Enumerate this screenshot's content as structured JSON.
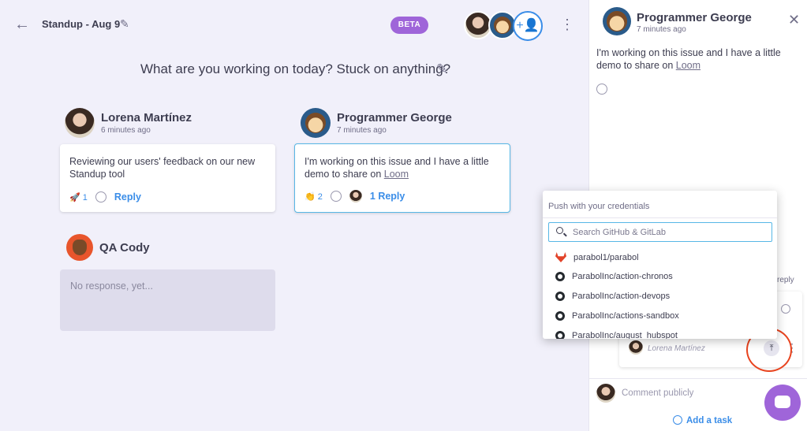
{
  "header": {
    "title": "Standup - Aug 9",
    "beta_badge": "BETA"
  },
  "prompt": "What are you working on today? Stuck on anything?",
  "responses": [
    {
      "name": "Lorena Martínez",
      "time": "6 minutes ago",
      "text": "Reviewing our users' feedback on our new Standup tool",
      "reaction_emoji": "🚀",
      "reaction_count": "1",
      "reply_label": "Reply"
    },
    {
      "name": "Programmer George",
      "time": "7 minutes ago",
      "text_before_link": "I'm working on this issue and I have a little demo to share on ",
      "link": "Loom",
      "reaction_emoji": "👏",
      "reaction_count": "2",
      "reply_label": "1 Reply"
    },
    {
      "name": "QA Cody",
      "empty_text": "No response, yet..."
    }
  ],
  "thread_panel": {
    "name": "Programmer George",
    "time": "7 minutes ago",
    "text_before_link": "I'm working on this issue and I have a little demo to share on ",
    "link": "Loom",
    "reply_partial": "reply",
    "comment_author": "Lorena Martínez",
    "comment_placeholder": "Comment publicly",
    "add_task": "Add a task"
  },
  "integration_menu": {
    "header": "Push with your credentials",
    "search_placeholder": "Search GitHub & GitLab",
    "items": [
      {
        "label": "parabol1/parabol",
        "icon": "gitlab-icon"
      },
      {
        "label": "ParabolInc/action-chronos",
        "icon": "github-icon"
      },
      {
        "label": "ParabolInc/action-devops",
        "icon": "github-icon"
      },
      {
        "label": "ParabolInc/actions-sandbox",
        "icon": "github-icon"
      },
      {
        "label": "ParabolInc/august_hubspot",
        "icon": "github-icon"
      }
    ]
  },
  "colors": {
    "accent": "#3a8de8",
    "beta": "#9f65d9",
    "highlight_ring": "#e8431e"
  }
}
